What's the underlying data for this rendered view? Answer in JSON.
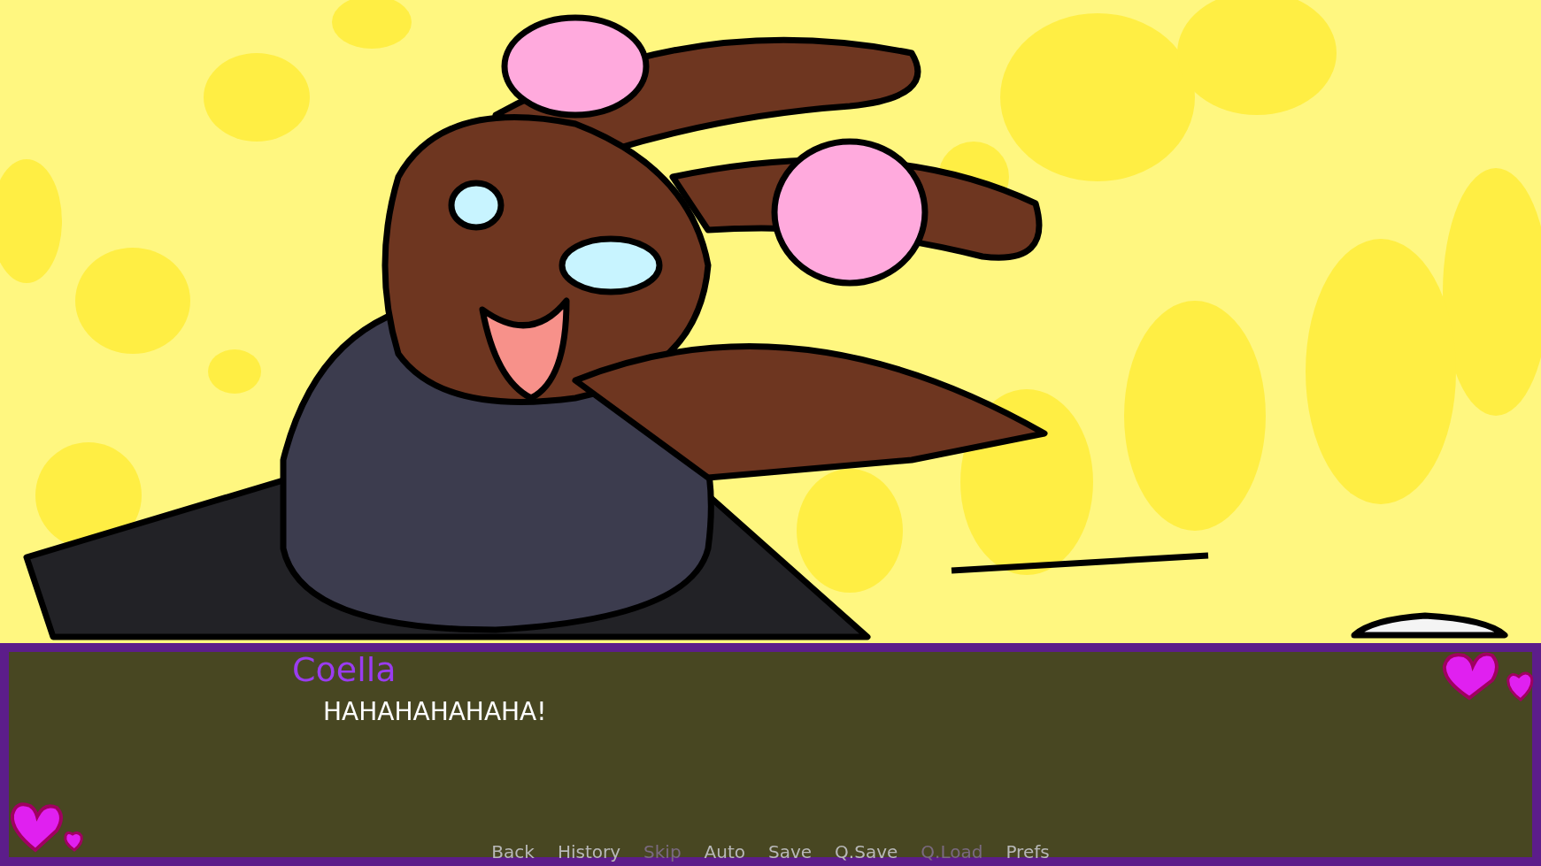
{
  "dialogue": {
    "speaker": "Coella",
    "text": "HAHAHAHAHAHA!"
  },
  "quick_menu": [
    {
      "label": "Back",
      "disabled": false
    },
    {
      "label": "History",
      "disabled": false
    },
    {
      "label": "Skip",
      "disabled": true
    },
    {
      "label": "Auto",
      "disabled": false
    },
    {
      "label": "Save",
      "disabled": false
    },
    {
      "label": "Q.Save",
      "disabled": false
    },
    {
      "label": "Q.Load",
      "disabled": true
    },
    {
      "label": "Prefs",
      "disabled": false
    }
  ]
}
